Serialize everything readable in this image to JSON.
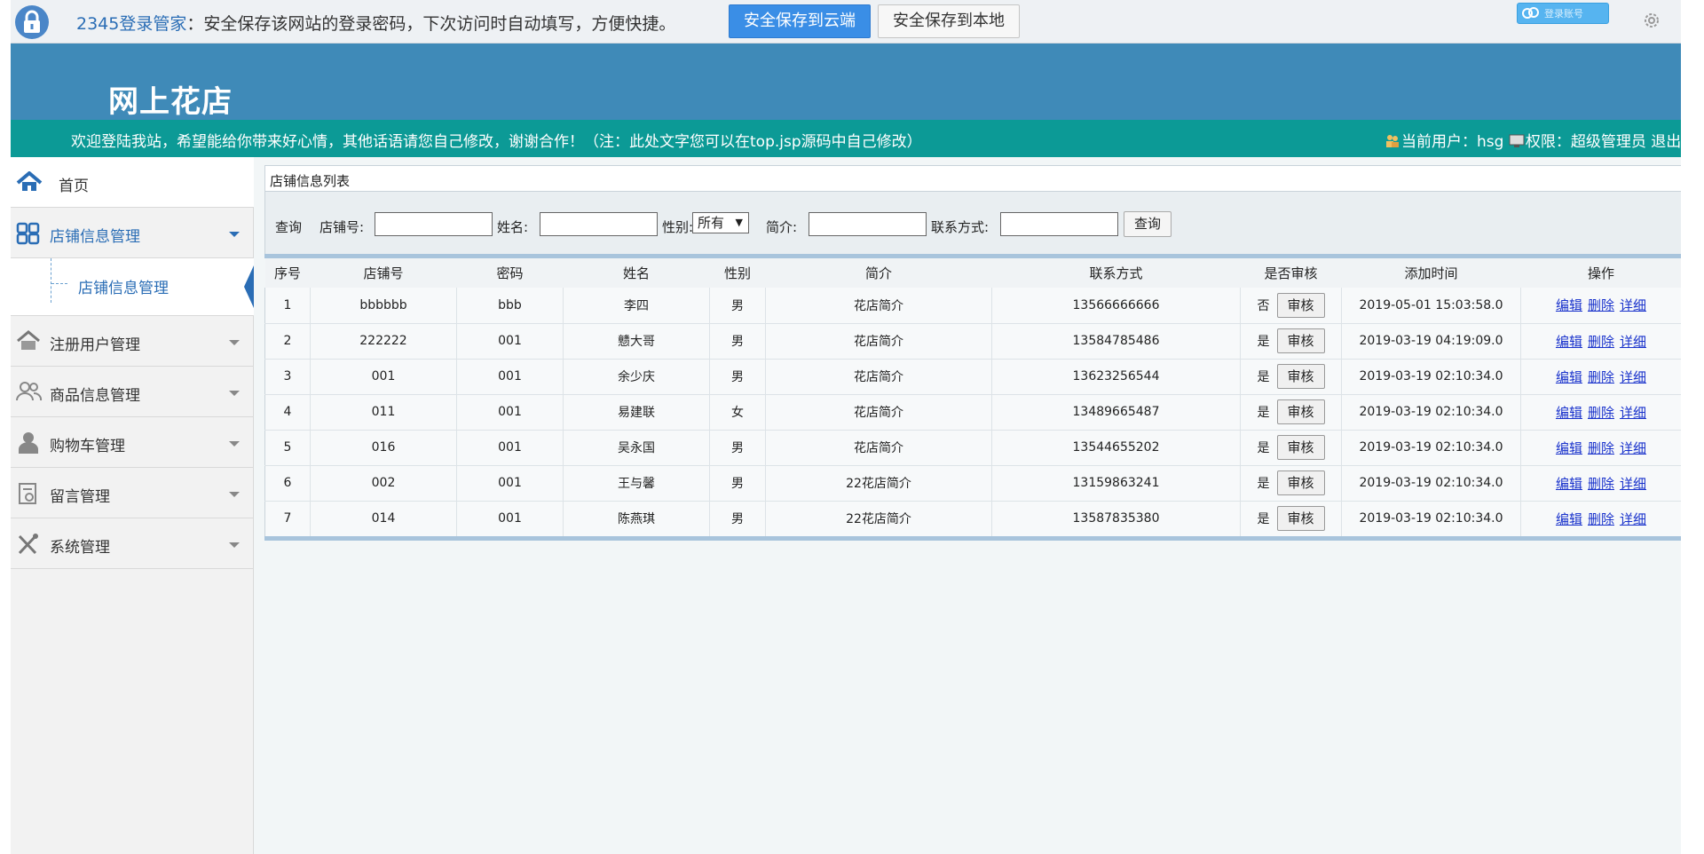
{
  "password_bar": {
    "brand": "2345登录管家",
    "message": "：安全保存该网站的登录密码，下次访问时自动填写，方便快捷。",
    "save_cloud": "安全保存到云端",
    "save_local": "安全保存到本地",
    "login_label": "登录账号"
  },
  "header": {
    "site_title": "网上花店",
    "welcome": "欢迎登陆我站，希望能给你带来好心情，其他话语请您自己修改，谢谢合作！（注：此处文字您可以在top.jsp源码中自己修改）",
    "current_user_label": "当前用户：hsg",
    "role_label": "权限：超级管理员",
    "logout": "退出"
  },
  "sidebar": {
    "home": "首页",
    "items": [
      {
        "label": "店铺信息管理",
        "icon": "grid-icon"
      },
      {
        "label": "注册用户管理",
        "icon": "house-icon"
      },
      {
        "label": "商品信息管理",
        "icon": "users-icon"
      },
      {
        "label": "购物车管理",
        "icon": "person-icon"
      },
      {
        "label": "留言管理",
        "icon": "note-icon"
      },
      {
        "label": "系统管理",
        "icon": "tools-icon"
      }
    ],
    "sub_item": "店铺信息管理"
  },
  "panel": {
    "title": "店铺信息列表"
  },
  "search": {
    "query_label": "查询",
    "shop_no_label": "店铺号:",
    "name_label": "姓名:",
    "gender_label": "性别:",
    "gender_value": "所有",
    "intro_label": "简介:",
    "contact_label": "联系方式:",
    "query_button": "查询"
  },
  "table": {
    "headers": [
      "序号",
      "店铺号",
      "密码",
      "姓名",
      "性别",
      "简介",
      "联系方式",
      "是否审核",
      "添加时间",
      "操作"
    ],
    "audit_button": "审核",
    "actions": [
      "编辑",
      "删除",
      "详细"
    ],
    "rows": [
      {
        "no": "1",
        "shop": "bbbbbb",
        "pwd": "bbb",
        "name": "李四",
        "gender": "男",
        "intro": "花店简介",
        "contact": "13566666666",
        "audited": "否",
        "time": "2019-05-01 15:03:58.0"
      },
      {
        "no": "2",
        "shop": "222222",
        "pwd": "001",
        "name": "戆大哥",
        "gender": "男",
        "intro": "花店简介",
        "contact": "13584785486",
        "audited": "是",
        "time": "2019-03-19 04:19:09.0"
      },
      {
        "no": "3",
        "shop": "001",
        "pwd": "001",
        "name": "余少庆",
        "gender": "男",
        "intro": "花店简介",
        "contact": "13623256544",
        "audited": "是",
        "time": "2019-03-19 02:10:34.0"
      },
      {
        "no": "4",
        "shop": "011",
        "pwd": "001",
        "name": "易建联",
        "gender": "女",
        "intro": "花店简介",
        "contact": "13489665487",
        "audited": "是",
        "time": "2019-03-19 02:10:34.0"
      },
      {
        "no": "5",
        "shop": "016",
        "pwd": "001",
        "name": "吴永国",
        "gender": "男",
        "intro": "花店简介",
        "contact": "13544655202",
        "audited": "是",
        "time": "2019-03-19 02:10:34.0"
      },
      {
        "no": "6",
        "shop": "002",
        "pwd": "001",
        "name": "王与馨",
        "gender": "男",
        "intro": "22花店简介",
        "contact": "13159863241",
        "audited": "是",
        "time": "2019-03-19 02:10:34.0"
      },
      {
        "no": "7",
        "shop": "014",
        "pwd": "001",
        "name": "陈燕琪",
        "gender": "男",
        "intro": "22花店简介",
        "contact": "13587835380",
        "audited": "是",
        "time": "2019-03-19 02:10:34.0"
      }
    ]
  },
  "colors": {
    "header_blue": "#3f8ab8",
    "welcome_teal": "#0c9a96",
    "link_blue": "#1a33cc",
    "accent": "#2a6db5"
  }
}
